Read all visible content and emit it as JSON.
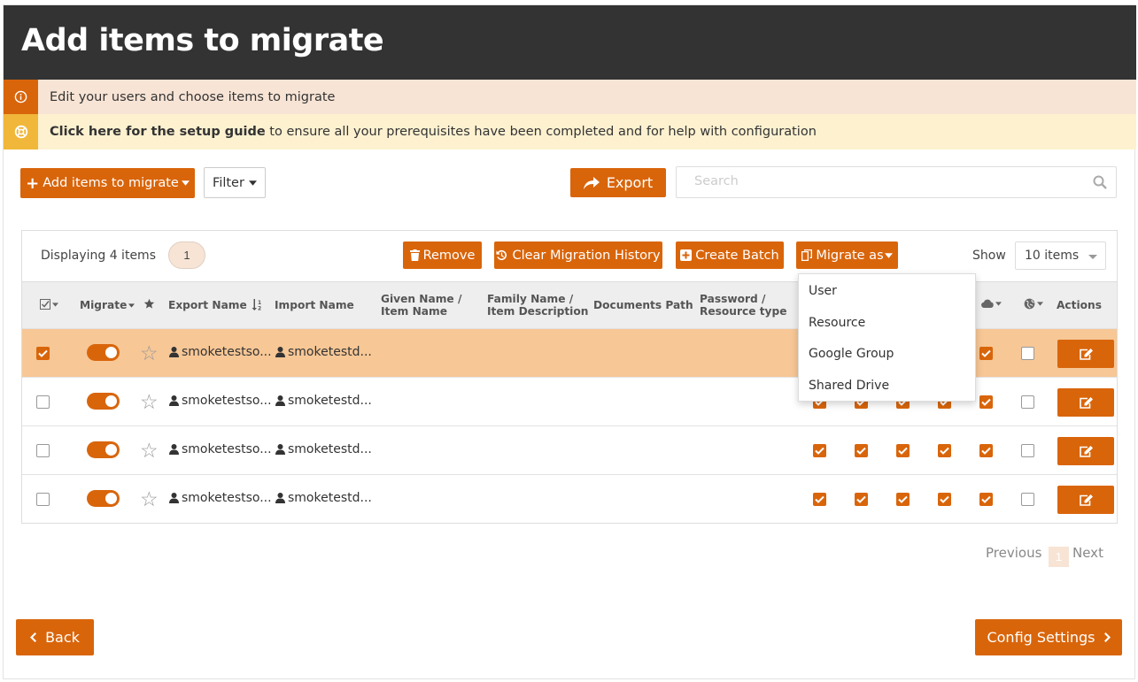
{
  "header": {
    "title": "Add items to migrate"
  },
  "banners": {
    "info_text": "Edit your users and choose items to migrate",
    "guide_bold": "Click here for the setup guide",
    "guide_rest": " to ensure all your prerequisites have been completed and for help with configuration"
  },
  "toolbar": {
    "add_label": "Add items to migrate",
    "filter_label": "Filter",
    "export_label": "Export",
    "search_placeholder": "Search"
  },
  "panel": {
    "displaying": "Displaying 4 items",
    "selected_count": "1",
    "remove_label": "Remove",
    "clear_label": "Clear Migration History",
    "batch_label": "Create Batch",
    "migrate_as_label": "Migrate as",
    "show_label": "Show",
    "show_value": "10 items"
  },
  "columns": {
    "migrate": "Migrate",
    "export_name": "Export Name",
    "import_name": "Import Name",
    "given_name": "Given Name / Item Name",
    "family_name": "Family Name / Item Description",
    "documents_path": "Documents Path",
    "password": "Password / Resource type",
    "actions": "Actions"
  },
  "rows": [
    {
      "selected": true,
      "migrate": true,
      "export_name": "smoketestso...",
      "import_name": "smoketestd...",
      "checks": [
        true,
        true,
        true,
        true,
        true,
        false
      ]
    },
    {
      "selected": false,
      "migrate": true,
      "export_name": "smoketestso...",
      "import_name": "smoketestd...",
      "checks": [
        true,
        true,
        true,
        true,
        true,
        false
      ]
    },
    {
      "selected": false,
      "migrate": true,
      "export_name": "smoketestso...",
      "import_name": "smoketestd...",
      "checks": [
        true,
        true,
        true,
        true,
        true,
        false
      ]
    },
    {
      "selected": false,
      "migrate": true,
      "export_name": "smoketestso...",
      "import_name": "smoketestd...",
      "checks": [
        true,
        true,
        true,
        true,
        true,
        false
      ]
    }
  ],
  "migrate_as_menu": [
    "User",
    "Resource",
    "Google Group",
    "Shared Drive"
  ],
  "pagination": {
    "previous": "Previous",
    "page": "1",
    "next": "Next"
  },
  "footer": {
    "back_label": "Back",
    "config_label": "Config Settings"
  },
  "colors": {
    "accent": "#d9650b",
    "header_bg": "#333333",
    "selected_row": "#f7c796"
  }
}
